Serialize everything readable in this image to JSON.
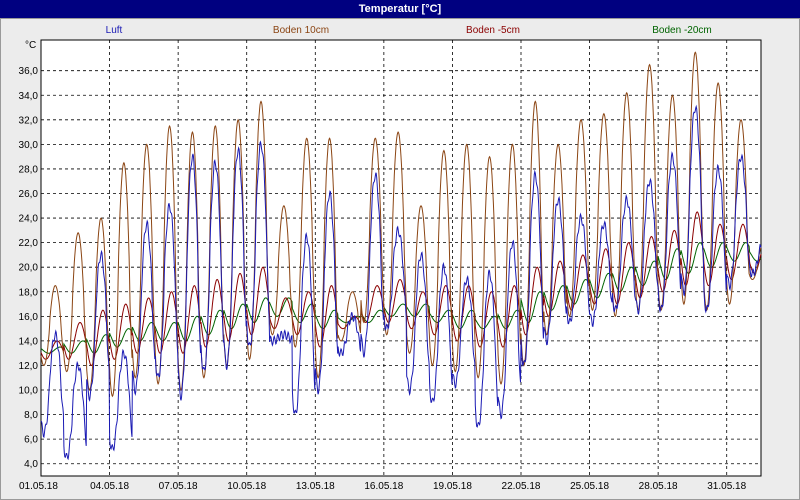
{
  "window": {
    "title": "Temperatur [°C]"
  },
  "colors": {
    "background": "#ececec",
    "plot_bg": "#ffffff",
    "grid": "#000000",
    "Luft": "#1a1ab4",
    "Boden 10cm": "#8b4513",
    "Boden -5cm": "#8b0000",
    "Boden -20cm": "#006400"
  },
  "chart_data": {
    "type": "line",
    "title": "Temperatur [°C]",
    "ylabel": "°C",
    "xlabel": "",
    "ylim": [
      3,
      38.5
    ],
    "xlim": [
      "2018-05-01",
      "2018-06-01"
    ],
    "grid": true,
    "legend_position": "top",
    "y_ticks": [
      "4,0",
      "6,0",
      "8,0",
      "10,0",
      "12,0",
      "14,0",
      "16,0",
      "18,0",
      "20,0",
      "22,0",
      "24,0",
      "26,0",
      "28,0",
      "30,0",
      "32,0",
      "34,0",
      "36,0"
    ],
    "x_ticks": [
      "01.05.18",
      "04.05.18",
      "07.05.18",
      "10.05.18",
      "13.05.18",
      "16.05.18",
      "19.05.18",
      "22.05.18",
      "25.05.18",
      "28.05.18",
      "31.05.18"
    ],
    "x_tick_dates": [
      "2018-05-01",
      "2018-05-04",
      "2018-05-07",
      "2018-05-10",
      "2018-05-13",
      "2018-05-16",
      "2018-05-19",
      "2018-05-22",
      "2018-05-25",
      "2018-05-28",
      "2018-05-31"
    ],
    "days": [
      "2018-05-01",
      "2018-05-02",
      "2018-05-03",
      "2018-05-04",
      "2018-05-05",
      "2018-05-06",
      "2018-05-07",
      "2018-05-08",
      "2018-05-09",
      "2018-05-10",
      "2018-05-11",
      "2018-05-12",
      "2018-05-13",
      "2018-05-14",
      "2018-05-15",
      "2018-05-16",
      "2018-05-17",
      "2018-05-18",
      "2018-05-19",
      "2018-05-20",
      "2018-05-21",
      "2018-05-22",
      "2018-05-23",
      "2018-05-24",
      "2018-05-25",
      "2018-05-26",
      "2018-05-27",
      "2018-05-28",
      "2018-05-29",
      "2018-05-30",
      "2018-05-31",
      "2018-06-01"
    ],
    "series": [
      {
        "name": "Luft",
        "daily_min": [
          6.5,
          4.5,
          9.5,
          5.2,
          10.0,
          11.0,
          9.5,
          11.5,
          12.0,
          13.5,
          14.0,
          8.0,
          10.0,
          13.0,
          13.0,
          15.0,
          10.0,
          9.0,
          10.5,
          7.0,
          8.0,
          12.0,
          14.0,
          15.5,
          15.5,
          16.5,
          16.5,
          16.5,
          18.0,
          16.5,
          18.5,
          19.5
        ],
        "daily_max": [
          14.5,
          12.0,
          21.0,
          13.0,
          23.5,
          25.0,
          29.0,
          28.5,
          29.5,
          30.0,
          14.5,
          22.5,
          26.0,
          16.0,
          27.5,
          23.0,
          21.0,
          20.0,
          19.0,
          19.5,
          22.0,
          27.5,
          25.5,
          24.0,
          23.5,
          25.5,
          27.0,
          29.0,
          33.0,
          28.0,
          29.0,
          22.0
        ]
      },
      {
        "name": "Boden 10cm",
        "daily_min": [
          12.0,
          11.5,
          10.0,
          9.5,
          11.0,
          10.5,
          10.0,
          11.0,
          12.0,
          12.5,
          14.5,
          13.5,
          11.0,
          14.0,
          15.5,
          14.5,
          13.0,
          12.0,
          11.5,
          11.0,
          10.5,
          12.0,
          14.5,
          16.0,
          16.5,
          16.0,
          16.5,
          16.5,
          17.0,
          16.5,
          17.0,
          19.0
        ],
        "daily_max": [
          18.5,
          22.8,
          24.0,
          28.5,
          30.0,
          31.5,
          31.0,
          31.5,
          32.0,
          33.5,
          25.0,
          30.5,
          30.5,
          18.0,
          30.5,
          31.0,
          25.0,
          29.5,
          30.0,
          29.0,
          30.0,
          33.5,
          30.0,
          32.0,
          32.5,
          34.2,
          36.5,
          34.0,
          37.5,
          35.0,
          32.0,
          22.0
        ]
      },
      {
        "name": "Boden -5cm",
        "daily_min": [
          12.5,
          12.5,
          12.0,
          12.5,
          13.0,
          13.0,
          13.0,
          13.5,
          14.0,
          14.5,
          15.0,
          14.5,
          13.5,
          15.0,
          15.5,
          15.5,
          15.0,
          14.5,
          14.0,
          13.5,
          13.5,
          14.5,
          16.0,
          16.5,
          17.0,
          17.0,
          17.5,
          18.0,
          18.5,
          18.5,
          19.0,
          19.5
        ],
        "daily_max": [
          14.0,
          15.5,
          16.5,
          17.0,
          17.5,
          18.0,
          18.5,
          19.0,
          19.5,
          20.0,
          17.5,
          18.0,
          18.5,
          16.0,
          18.5,
          19.0,
          18.0,
          18.5,
          18.5,
          18.0,
          18.5,
          20.0,
          20.5,
          21.0,
          21.5,
          22.0,
          22.5,
          23.0,
          24.5,
          23.5,
          23.5,
          22.0
        ]
      },
      {
        "name": "Boden -20cm",
        "daily_min": [
          13.0,
          13.0,
          13.0,
          13.5,
          14.0,
          14.0,
          14.0,
          14.5,
          15.0,
          15.5,
          16.0,
          15.5,
          15.0,
          15.5,
          15.5,
          16.0,
          16.0,
          15.5,
          15.0,
          15.0,
          15.0,
          15.5,
          16.5,
          17.0,
          17.5,
          18.0,
          18.5,
          19.0,
          19.5,
          20.0,
          20.5,
          20.5
        ],
        "daily_max": [
          13.5,
          14.0,
          14.5,
          15.0,
          15.5,
          15.5,
          16.0,
          16.5,
          17.0,
          17.5,
          17.5,
          17.0,
          16.5,
          16.0,
          16.5,
          17.0,
          17.0,
          16.5,
          16.5,
          16.0,
          16.5,
          18.0,
          18.5,
          19.0,
          19.5,
          20.0,
          20.5,
          21.5,
          22.0,
          22.0,
          22.0,
          21.5
        ]
      }
    ]
  }
}
